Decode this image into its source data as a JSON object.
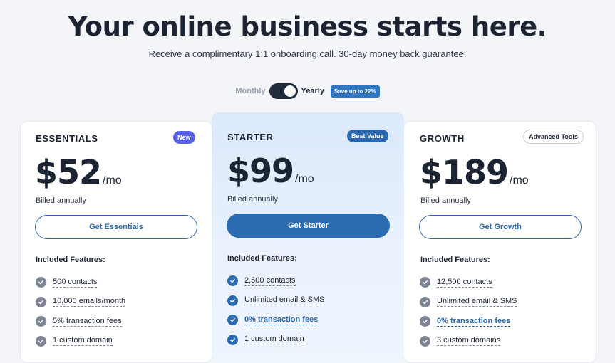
{
  "hero": {
    "title": "Your online business starts here.",
    "subtitle": "Receive a complimentary 1:1 onboarding call. 30-day money back guarantee."
  },
  "billing_toggle": {
    "monthly_label": "Monthly",
    "yearly_label": "Yearly",
    "selected": "Yearly",
    "save_badge": "Save up to 22%"
  },
  "plans": [
    {
      "name": "ESSENTIALS",
      "tag": "New",
      "price": "$52",
      "per": "/mo",
      "billed": "Billed annually",
      "cta": "Get Essentials",
      "features_heading": "Included Features:",
      "features": [
        {
          "text": "500 contacts",
          "highlight": false
        },
        {
          "text": "10,000 emails/month",
          "highlight": false
        },
        {
          "text": "5% transaction fees",
          "highlight": false
        },
        {
          "text": "1 custom domain",
          "highlight": false
        }
      ]
    },
    {
      "name": "STARTER",
      "tag": "Best Value",
      "price": "$99",
      "per": "/mo",
      "billed": "Billed annually",
      "cta": "Get Starter",
      "features_heading": "Included Features:",
      "features": [
        {
          "text": "2,500 contacts",
          "highlight": false
        },
        {
          "text": "Unlimited email & SMS",
          "highlight": false
        },
        {
          "text": "0% transaction fees",
          "highlight": true
        },
        {
          "text": "1 custom domain",
          "highlight": false
        }
      ]
    },
    {
      "name": "GROWTH",
      "tag": "Advanced Tools",
      "price": "$189",
      "per": "/mo",
      "billed": "Billed annually",
      "cta": "Get Growth",
      "features_heading": "Included Features:",
      "features": [
        {
          "text": "12,500 contacts",
          "highlight": false
        },
        {
          "text": "Unlimited email & SMS",
          "highlight": false
        },
        {
          "text": "0% transaction fees",
          "highlight": true
        },
        {
          "text": "3 custom domains",
          "highlight": false
        }
      ]
    }
  ],
  "colors": {
    "accent": "#2a6bb1",
    "dark": "#1c2433",
    "new_tag": "#5661e5",
    "featured_bg": "#dbe9fb"
  }
}
